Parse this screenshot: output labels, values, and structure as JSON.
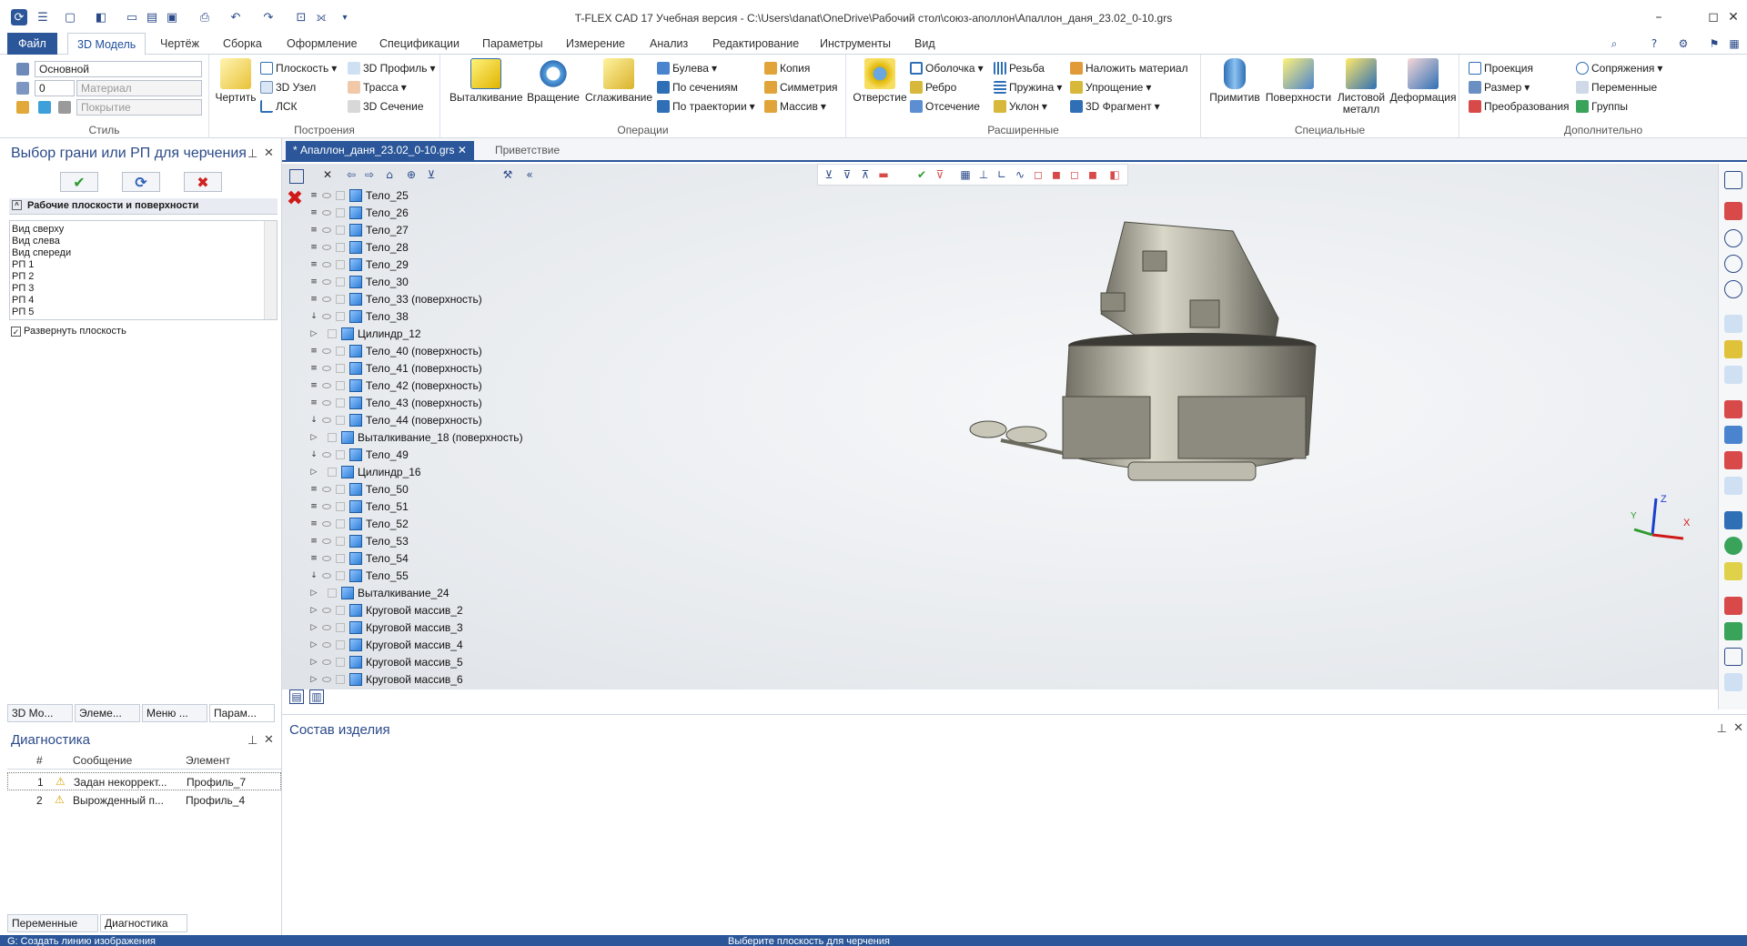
{
  "window": {
    "title": "T-FLEX CAD 17 Учебная версия - C:\\Users\\danat\\OneDrive\\Рабочий стол\\союз-аполлон\\Апаллон_даня_23.02_0-10.grs"
  },
  "menu": {
    "tabs": [
      "Файл",
      "3D Модель",
      "Чертёж",
      "Сборка",
      "Оформление",
      "Спецификации",
      "Параметры",
      "Измерение",
      "Анализ",
      "Редактирование",
      "Инструменты",
      "Вид"
    ]
  },
  "ribbon": {
    "style": {
      "label": "Стиль",
      "layer": "Основной",
      "line_number": "0",
      "material_placeholder": "Материал",
      "coating_placeholder": "Покрытие"
    },
    "constructions": {
      "label": "Построения",
      "draw": "Чертить",
      "plane": "Плоскость",
      "node3d": "3D Узел",
      "lcs": "ЛСК",
      "profile3d": "3D Профиль",
      "path": "Трасса",
      "section3d": "3D Сечение"
    },
    "operations": {
      "label": "Операции",
      "extrude": "Выталкивание",
      "revolve": "Вращение",
      "loft": "Сглаживание",
      "boolean": "Булева",
      "by_sections": "По сечениям",
      "by_path": "По траектории",
      "copy": "Копия",
      "symmetry": "Симметрия",
      "array": "Массив"
    },
    "extended": {
      "label": "Расширенные",
      "hole": "Отверстие",
      "shell": "Оболочка",
      "rib": "Ребро",
      "cut": "Отсечение",
      "thread": "Резьба",
      "spring": "Пружина",
      "draft": "Уклон",
      "apply_material": "Наложить материал",
      "simplify": "Упрощение",
      "fragment3d": "3D Фрагмент"
    },
    "special": {
      "label": "Специальные",
      "primitives": "Примитив",
      "surfaces": "Поверхности",
      "sheet_metal_1": "Листовой",
      "sheet_metal_2": "металл",
      "deformation": "Деформация"
    },
    "extra": {
      "label": "Дополнительно",
      "projection": "Проекция",
      "size": "Размер",
      "transform": "Преобразования",
      "mates": "Сопряжения",
      "variables": "Переменные",
      "groups": "Группы"
    }
  },
  "left_panel": {
    "title": "Выбор грани или РП для черчения",
    "section": "Рабочие плоскости и поверхности",
    "list": [
      "Вид сверху",
      "Вид слева",
      "Вид спереди",
      "РП 1",
      "РП 2",
      "РП 3",
      "РП 4",
      "РП 5"
    ],
    "checkbox_label": "Развернуть плоскость",
    "tabs": [
      "3D Мо...",
      "Элеме...",
      "Меню ...",
      "Парам..."
    ]
  },
  "diagnostics": {
    "title": "Диагностика",
    "columns": [
      "#",
      "Сообщение",
      "Элемент"
    ],
    "rows": [
      {
        "num": "1",
        "message": "Задан некоррект...",
        "element": "Профиль_7"
      },
      {
        "num": "2",
        "message": "Вырожденный п...",
        "element": "Профиль_4"
      }
    ],
    "tabs": [
      "Переменные",
      "Диагностика"
    ]
  },
  "document_tabs": [
    "* Апаллон_даня_23.02_0-10.grs",
    "Приветствие"
  ],
  "tree": [
    {
      "label": "Тело_25",
      "g": "≡"
    },
    {
      "label": "Тело_26",
      "g": "≡"
    },
    {
      "label": "Тело_27",
      "g": "≡"
    },
    {
      "label": "Тело_28",
      "g": "≡"
    },
    {
      "label": "Тело_29",
      "g": "≡"
    },
    {
      "label": "Тело_30",
      "g": "≡"
    },
    {
      "label": "Тело_33 (поверхность)",
      "g": "≡"
    },
    {
      "label": "Тело_38",
      "g": "↓"
    },
    {
      "label": "Цилиндр_12",
      "g": "▷",
      "indent": 1
    },
    {
      "label": "Тело_40 (поверхность)",
      "g": "≡"
    },
    {
      "label": "Тело_41 (поверхность)",
      "g": "≡"
    },
    {
      "label": "Тело_42 (поверхность)",
      "g": "≡"
    },
    {
      "label": "Тело_43 (поверхность)",
      "g": "≡"
    },
    {
      "label": "Тело_44 (поверхность)",
      "g": "↓"
    },
    {
      "label": "Выталкивание_18 (поверхность)",
      "g": "▷",
      "indent": 1
    },
    {
      "label": "Тело_49",
      "g": "↓"
    },
    {
      "label": "Цилиндр_16",
      "g": "▷",
      "indent": 1
    },
    {
      "label": "Тело_50",
      "g": "≡"
    },
    {
      "label": "Тело_51",
      "g": "≡"
    },
    {
      "label": "Тело_52",
      "g": "≡"
    },
    {
      "label": "Тело_53",
      "g": "≡"
    },
    {
      "label": "Тело_54",
      "g": "≡"
    },
    {
      "label": "Тело_55",
      "g": "↓"
    },
    {
      "label": "Выталкивание_24",
      "g": "▷",
      "indent": 1
    },
    {
      "label": "Круговой массив_2",
      "g": "▷"
    },
    {
      "label": "Круговой массив_3",
      "g": "▷"
    },
    {
      "label": "Круговой массив_4",
      "g": "▷"
    },
    {
      "label": "Круговой массив_5",
      "g": "▷"
    },
    {
      "label": "Круговой массив_6",
      "g": "▷"
    }
  ],
  "axes": {
    "x": "X",
    "y": "Y",
    "z": "Z"
  },
  "bottom_panel": {
    "title": "Состав изделия"
  },
  "status": {
    "left": "G: Создать линию изображения",
    "center": "Выберите плоскость для черчения"
  }
}
